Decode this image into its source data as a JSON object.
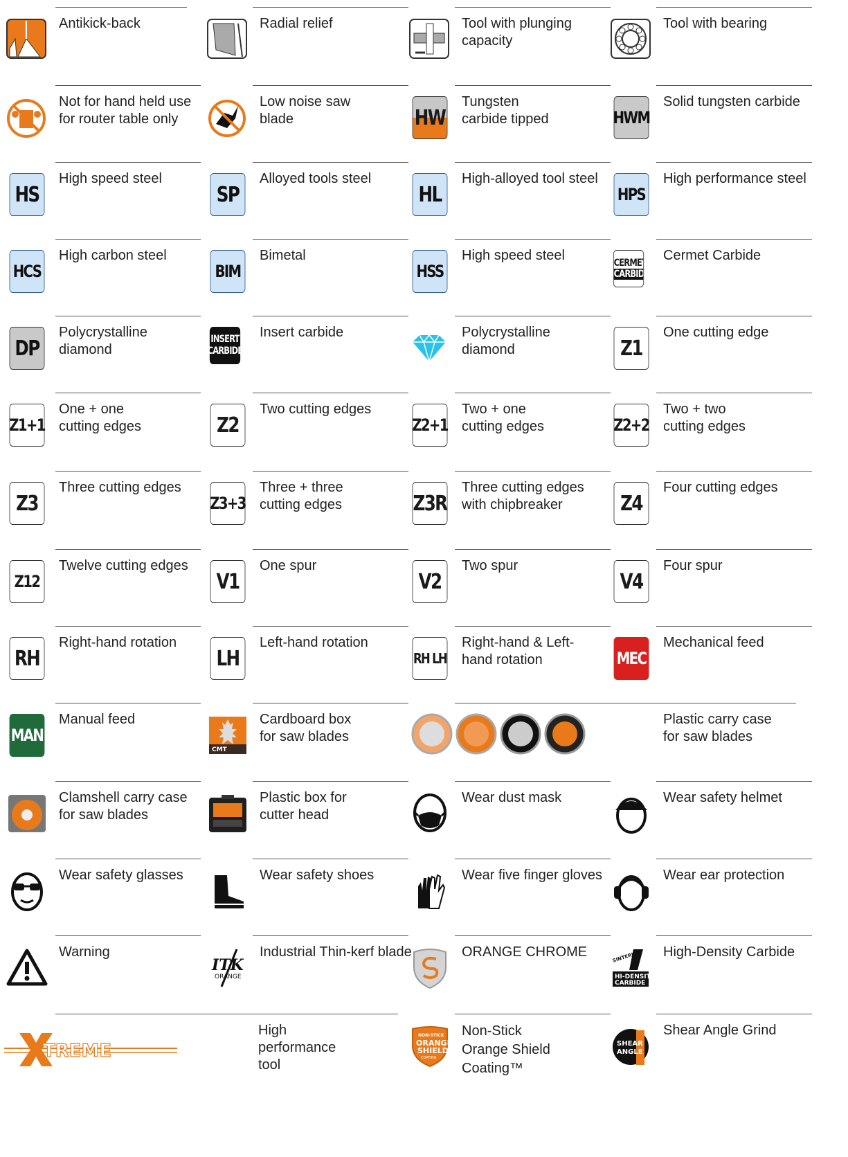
{
  "accent_orange": "#e87a1b",
  "items": [
    {
      "label": "Antikick-back",
      "icon": "antikickback-icon"
    },
    {
      "label": "Radial relief",
      "icon": "radial-relief-icon"
    },
    {
      "label": "Tool with plunging capacity",
      "icon": "plunging-icon"
    },
    {
      "label": "Tool with bearing",
      "icon": "bearing-icon"
    },
    {
      "label": "Not for hand held use for router table only",
      "icon": "no-hand-held-icon"
    },
    {
      "label": "Low noise saw blade",
      "icon": "low-noise-icon"
    },
    {
      "label": "Tungsten carbide tipped",
      "icon": "HW"
    },
    {
      "label": "Solid tungsten carbide",
      "icon": "HWM"
    },
    {
      "label": "High speed steel",
      "icon": "HS"
    },
    {
      "label": "Alloyed tools steel",
      "icon": "SP"
    },
    {
      "label": "High-alloyed tool steel",
      "icon": "HL"
    },
    {
      "label": "High performance steel",
      "icon": "HPS"
    },
    {
      "label": "High carbon steel",
      "icon": "HCS"
    },
    {
      "label": "Bimetal",
      "icon": "BIM"
    },
    {
      "label": "High speed steel",
      "icon": "HSS"
    },
    {
      "label": "Cermet Carbide",
      "icon": "CERMET CARBIDE"
    },
    {
      "label": "Polycrystalline diamond",
      "icon": "DP"
    },
    {
      "label": "Insert carbide",
      "icon": "INSERT CARBIDE"
    },
    {
      "label": "Polycrystalline diamond",
      "icon": "diamond-icon"
    },
    {
      "label": "One cutting edge",
      "icon": "Z1"
    },
    {
      "label": "One + one cutting edges",
      "icon": "Z1+1"
    },
    {
      "label": "Two cutting edges",
      "icon": "Z2"
    },
    {
      "label": "Two + one cutting edges",
      "icon": "Z2+1"
    },
    {
      "label": "Two + two cutting edges",
      "icon": "Z2+2"
    },
    {
      "label": "Three cutting edges",
      "icon": "Z3"
    },
    {
      "label": "Three + three cutting edges",
      "icon": "Z3+3"
    },
    {
      "label": "Three cutting edges with chipbreaker",
      "icon": "Z3R"
    },
    {
      "label": "Four cutting edges",
      "icon": "Z4"
    },
    {
      "label": "Twelve cutting edges",
      "icon": "Z12"
    },
    {
      "label": "One spur",
      "icon": "V1"
    },
    {
      "label": "Two spur",
      "icon": "V2"
    },
    {
      "label": "Four spur",
      "icon": "V4"
    },
    {
      "label": "Right-hand rotation",
      "icon": "RH"
    },
    {
      "label": "Left-hand rotation",
      "icon": "LH"
    },
    {
      "label": "Right-hand & Left-hand rotation",
      "icon": "RH LH"
    },
    {
      "label": "Mechanical feed",
      "icon": "MEC"
    },
    {
      "label": "Manual feed",
      "icon": "MAN"
    },
    {
      "label": "Cardboard box for saw blades",
      "icon": "cardboard-box-icon"
    },
    {
      "label": "Plastic carry case for saw blades",
      "icon": "carry-case-icon"
    },
    {
      "label": "Clamshell carry case for saw blades",
      "icon": "clamshell-icon"
    },
    {
      "label": "Plastic box for cutter head",
      "icon": "plastic-box-icon"
    },
    {
      "label": "Wear dust mask",
      "icon": "dust-mask-icon"
    },
    {
      "label": "Wear safety helmet",
      "icon": "helmet-icon"
    },
    {
      "label": "Wear safety glasses",
      "icon": "glasses-icon"
    },
    {
      "label": "Wear safety shoes",
      "icon": "shoes-icon"
    },
    {
      "label": "Wear five finger gloves",
      "icon": "gloves-icon"
    },
    {
      "label": "Wear ear protection",
      "icon": "ear-protection-icon"
    },
    {
      "label": "Warning",
      "icon": "warning-icon"
    },
    {
      "label": "Industrial Thin-kerf blade",
      "icon": "itk-icon"
    },
    {
      "label": "ORANGE CHROME",
      "icon": "orange-chrome-icon"
    },
    {
      "label": "High-Density Carbide",
      "icon": "hd-carbide-icon"
    },
    {
      "label": "High performance tool",
      "icon": "xtreme-logo"
    },
    {
      "label": "Non-Stick Orange Shield Coating™",
      "icon": "orange-shield-icon"
    },
    {
      "label": "Shear Angle Grind",
      "icon": "shear-angle-icon"
    }
  ],
  "badge_text": {
    "itk": "ITK",
    "itk_sub": "ORANGE",
    "xtreme": "TREME",
    "shield_top": "NON-STICK",
    "shield_mid1": "ORANGE",
    "shield_mid2": "SHIELD",
    "shield_bot": "COATING",
    "shear1": "SHEAR",
    "shear2": "ANGLE",
    "hd1": "SINTERHIP",
    "hd2": "HI-DENSITY",
    "hd3": "CARBIDE",
    "cmt": "CMT"
  }
}
